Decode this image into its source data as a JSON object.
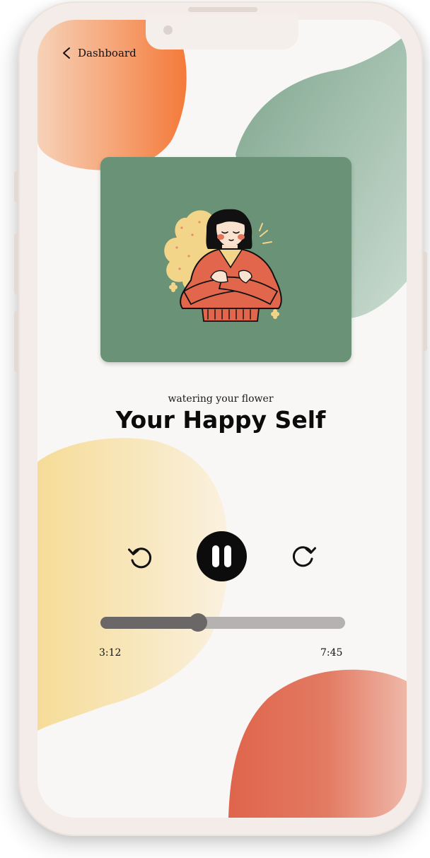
{
  "nav": {
    "back_label": "Dashboard"
  },
  "track": {
    "subtitle": "watering your flower",
    "title": "Your Happy Self",
    "elapsed": "3:12",
    "total": "7:45",
    "progress_fraction": 0.4
  },
  "controls": {
    "rewind_icon": "rotate-ccw-icon",
    "pause_icon": "pause-icon",
    "forward_icon": "rotate-cw-icon"
  },
  "colors": {
    "cover_bg": "#6a9277",
    "blob_orange": "#f47a3a",
    "blob_green": "#8fb39d",
    "blob_yellow": "#f7e2a8",
    "blob_red": "#df654c",
    "progress_fill": "#6b6766",
    "progress_track": "#b5b2b1"
  }
}
